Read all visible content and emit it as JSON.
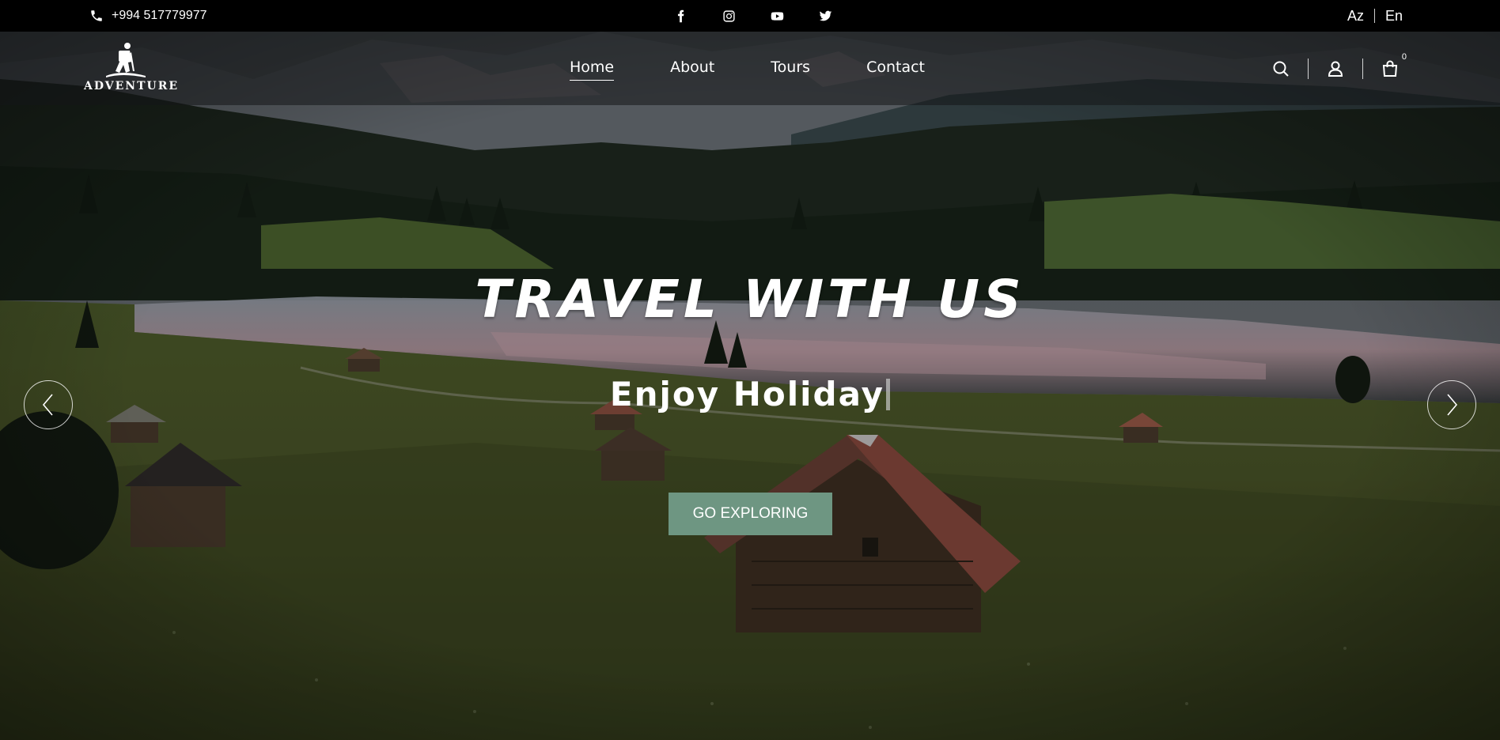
{
  "topbar": {
    "phone": "+994 517779977",
    "social": [
      "facebook-icon",
      "instagram-icon",
      "youtube-icon",
      "twitter-icon"
    ],
    "languages": [
      "Az",
      "En"
    ]
  },
  "header": {
    "logo_text": "ADVENTURE",
    "nav": [
      {
        "label": "Home",
        "active": true
      },
      {
        "label": "About",
        "active": false
      },
      {
        "label": "Tours",
        "active": false
      },
      {
        "label": "Contact",
        "active": false
      }
    ],
    "cart_count": "0"
  },
  "hero": {
    "title": "TRAVEL WITH US",
    "subtitle": "Enjoy Holiday",
    "button_label": "GO EXPLORING"
  },
  "colors": {
    "accent": "#6e9682",
    "topbar": "#000000"
  }
}
